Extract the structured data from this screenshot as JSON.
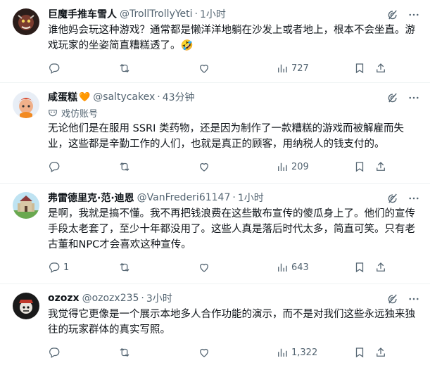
{
  "colors": {
    "text": "#0f1419",
    "muted": "#536471",
    "divider": "#eff3f4"
  },
  "posts": [
    {
      "name": "巨魔手推车雪人",
      "handle": "@TrollTrollyYeti",
      "time": "1小时",
      "text": "谁他妈会玩这种游戏？通常都是懒洋洋地躺在沙发上或者地上，根本不会坐直。游戏玩家的坐姿简直糟糕透了。🤣",
      "replies": "",
      "reposts": "",
      "likes": "",
      "views": "727"
    },
    {
      "name": "咸蛋糕",
      "name_badge": "🧡",
      "handle": "@saltycakex",
      "time": "43分钟",
      "parody_label": "戏仿账号",
      "text": "无论他们是在服用 SSRI 类药物，还是因为制作了一款糟糕的游戏而被解雇而失业，这些都是辛勤工作的人们，也就是真正的顾客，用纳税人的钱支付的。",
      "replies": "",
      "reposts": "",
      "likes": "",
      "views": "209"
    },
    {
      "name": "弗雷德里克·范·迪恩",
      "handle": "@VanFrederi61147",
      "time": "1小时",
      "text": "是啊，我就是搞不懂。我不再把钱浪费在这些散布宣传的傻瓜身上了。他们的宣传手段太老套了，至少十年都没用了。这些人真是落后时代太多，简直可笑。只有老古董和NPC才会喜欢这种宣传。",
      "replies": "1",
      "reposts": "",
      "likes": "",
      "views": "643"
    },
    {
      "name": "ozozx",
      "handle": "@ozozx235",
      "time": "3小时",
      "text": "我觉得它更像是一个展示本地多人合作功能的演示，而不是对我们这些永远独来独往的玩家群体的真实写照。",
      "replies": "",
      "reposts": "",
      "likes": "",
      "views": "1,322"
    }
  ]
}
